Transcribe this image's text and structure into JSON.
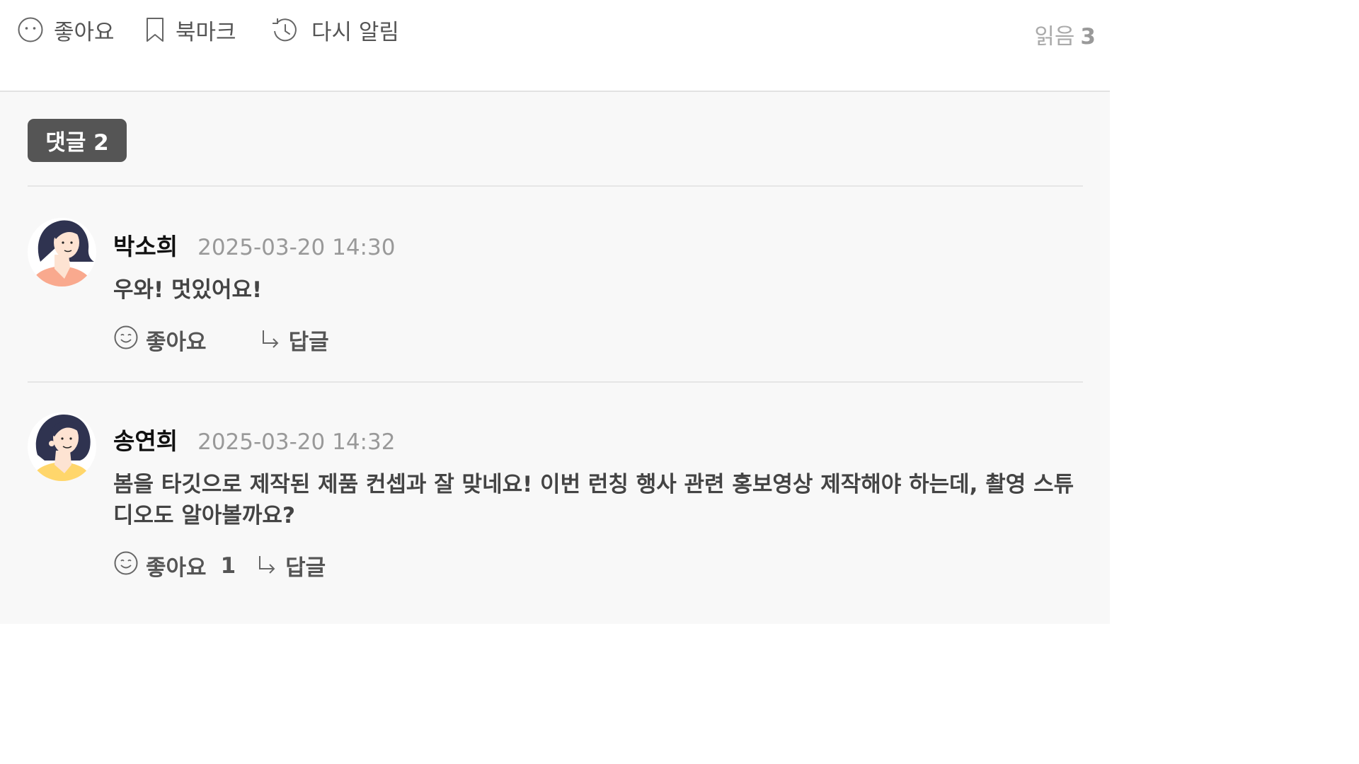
{
  "topbar": {
    "like_label": "좋아요",
    "bookmark_label": "북마크",
    "remind_label": "다시 알림",
    "read_label": "읽음",
    "read_count": "3"
  },
  "comments": {
    "badge_label": "댓글 2",
    "items": [
      {
        "author": "박소희",
        "time": "2025-03-20 14:30",
        "body": "우와! 멋있어요!",
        "like_label": "좋아요",
        "like_count": "",
        "reply_label": "답글",
        "avatar_shirt_color": "#f9a98e"
      },
      {
        "author": "송연희",
        "time": "2025-03-20 14:32",
        "body": "봄을 타깃으로 제작된 제품 컨셉과 잘 맞네요! 이번 런칭 행사 관련 홍보영상 제작해야 하는데, 촬영 스튜디오도 알아볼까요?",
        "like_label": "좋아요",
        "like_count": "1",
        "reply_label": "답글",
        "avatar_shirt_color": "#ffd66b"
      }
    ]
  },
  "colors": {
    "badge_bg": "#555555",
    "hair": "#2f3350",
    "skin": "#fde3d2",
    "muted_text": "#999999"
  }
}
